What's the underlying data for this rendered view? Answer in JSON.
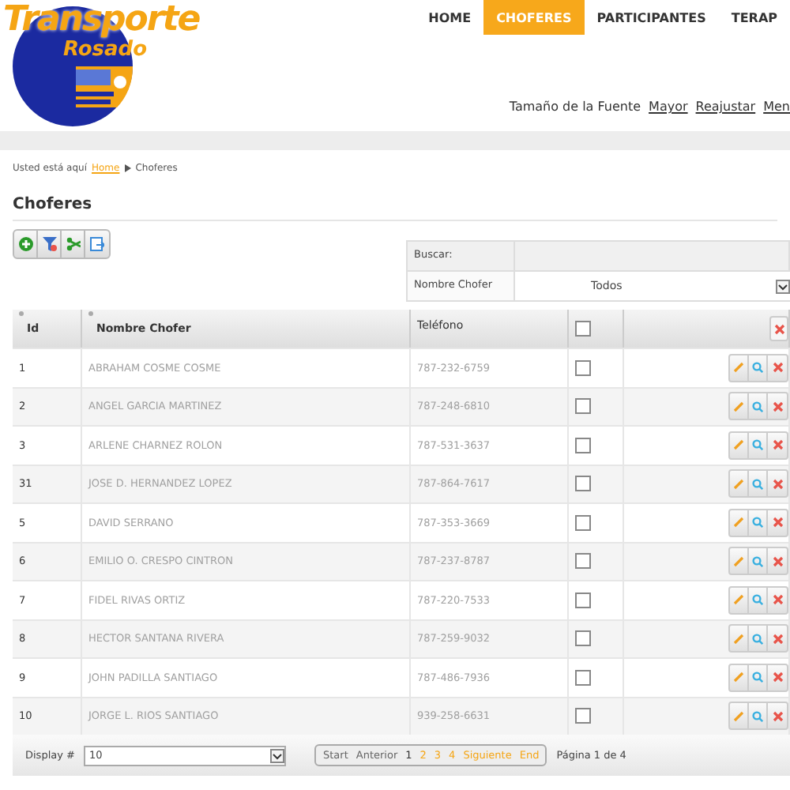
{
  "logo": {
    "line_1": "Transporte",
    "line_2": "Rosado"
  },
  "nav": [
    {
      "label": "HOME",
      "selected": false
    },
    {
      "label": "CHOFERES",
      "selected": true
    },
    {
      "label": "PARTICIPANTES",
      "selected": false
    },
    {
      "label": "TERAP",
      "selected": false
    }
  ],
  "font_size": {
    "label": "Tamaño de la Fuente",
    "links": [
      "Mayor",
      "Reajustar",
      "Men"
    ]
  },
  "breadcrumb": {
    "prefix": "Usted está aquí",
    "link": "Home",
    "current": "Choferes"
  },
  "title": "Choferes",
  "search": {
    "heading": "Buscar:",
    "field_label": "Nombre Chofer",
    "value": "Todos"
  },
  "table": {
    "columns": [
      {
        "kind": "text",
        "label": "Id",
        "sortable": true
      },
      {
        "kind": "text",
        "label": "Nombre Chofer",
        "sortable": true
      },
      {
        "kind": "text",
        "label": "Teléfono",
        "sortable": false
      },
      {
        "kind": "checkbox",
        "checked": false
      },
      {
        "kind": "actions"
      }
    ],
    "rows": [
      {
        "id": "1",
        "name": "ABRAHAM COSME COSME",
        "phone": "787-232-6759",
        "checked": false
      },
      {
        "id": "2",
        "name": "ANGEL GARCIA MARTINEZ",
        "phone": "787-248-6810",
        "checked": false
      },
      {
        "id": "3",
        "name": "ARLENE CHARNEZ ROLON",
        "phone": "787-531-3637",
        "checked": false
      },
      {
        "id": "31",
        "name": "JOSE D. HERNANDEZ LOPEZ",
        "phone": "787-864-7617",
        "checked": false
      },
      {
        "id": "5",
        "name": "DAVID SERRANO",
        "phone": "787-353-3669",
        "checked": false
      },
      {
        "id": "6",
        "name": "EMILIO O. CRESPO CINTRON",
        "phone": "787-237-8787",
        "checked": false
      },
      {
        "id": "7",
        "name": "FIDEL RIVAS ORTIZ",
        "phone": "787-220-7533",
        "checked": false
      },
      {
        "id": "8",
        "name": "HECTOR SANTANA RIVERA",
        "phone": "787-259-9032",
        "checked": false
      },
      {
        "id": "9",
        "name": "JOHN PADILLA SANTIAGO",
        "phone": "787-486-7936",
        "checked": false
      },
      {
        "id": "10",
        "name": "JORGE L. RIOS SANTIAGO",
        "phone": "939-258-6631",
        "checked": false
      }
    ]
  },
  "footer": {
    "display_label": "Display #",
    "display_value": "10",
    "pager": [
      {
        "label": "Start",
        "kind": "disabled"
      },
      {
        "label": "Anterior",
        "kind": "disabled"
      },
      {
        "label": "1",
        "kind": "current"
      },
      {
        "label": "2",
        "kind": "link"
      },
      {
        "label": "3",
        "kind": "link"
      },
      {
        "label": "4",
        "kind": "link"
      },
      {
        "label": "Siguiente",
        "kind": "link"
      },
      {
        "label": "End",
        "kind": "link"
      }
    ],
    "page_info": "Página 1 de 4"
  }
}
